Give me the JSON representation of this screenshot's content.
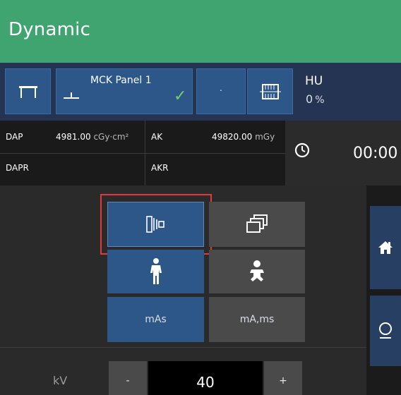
{
  "header": {
    "title": "Dynamic"
  },
  "topbar": {
    "panel_label": "MCK Panel 1",
    "panel_check": "✓",
    "dot_label": "·",
    "hu_label": "HU",
    "hu_value": "0",
    "hu_unit": "%"
  },
  "dose": {
    "dap_label": "DAP",
    "dap_value": "4981.00",
    "dap_unit": "cGy·cm²",
    "ak_label": "AK",
    "ak_value": "49820.00",
    "ak_unit": "mGy",
    "dapr_label": "DAPR",
    "akr_label": "AKR"
  },
  "timer": {
    "value": "00:00"
  },
  "exposure": {
    "mas_label": "mAs",
    "mams_label": "mA,ms"
  },
  "kv": {
    "label": "kV",
    "minus": "-",
    "value": "40",
    "plus": "+"
  },
  "colors": {
    "header_bg": "#3fa46f",
    "selected_blue": "#2d5689",
    "highlight_red": "#e03a3a",
    "check_green": "#6fd36a"
  }
}
